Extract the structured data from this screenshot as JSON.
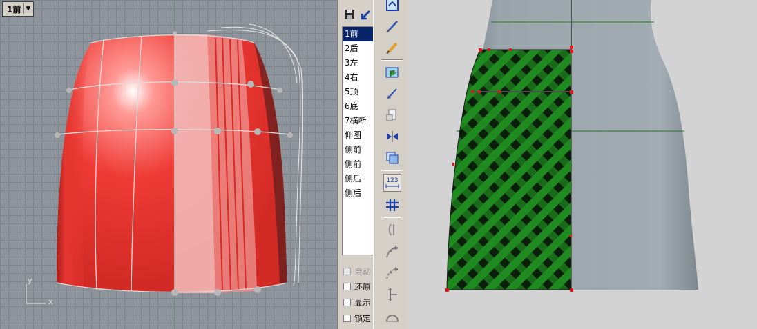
{
  "left_viewport": {
    "tab_label": "1前",
    "axis_y": "y",
    "axis_x": "x"
  },
  "view_panel": {
    "items": [
      "1前",
      "2后",
      "3左",
      "4右",
      "5顶",
      "6底",
      "7横断",
      "仰图",
      "侧前",
      "侧前",
      "侧后",
      "侧后"
    ],
    "selected_index": 0,
    "checkboxes": [
      {
        "label": "自动",
        "checked": false,
        "disabled": true
      },
      {
        "label": "还原",
        "checked": false,
        "disabled": false
      },
      {
        "label": "显示",
        "checked": false,
        "disabled": false
      },
      {
        "label": "锁定",
        "checked": false,
        "disabled": false
      }
    ]
  },
  "toolbar": {
    "tools": [
      {
        "icon": "view-icon",
        "pressed": false
      },
      {
        "icon": "pen-line-icon",
        "pressed": false
      },
      {
        "icon": "pencil-icon",
        "pressed": false
      },
      {
        "icon": "hand-view-icon",
        "pressed": false
      },
      {
        "icon": "arrow-line-icon",
        "pressed": false
      },
      {
        "icon": "cut-icon",
        "pressed": false
      },
      {
        "icon": "mirror-icon",
        "pressed": false
      },
      {
        "icon": "copy-icon",
        "pressed": false
      },
      {
        "icon": "dimension-icon",
        "label": "123",
        "pressed": true
      },
      {
        "icon": "grid-icon",
        "pressed": false
      },
      {
        "icon": "split-icon",
        "pressed": false
      },
      {
        "icon": "curve-add-icon",
        "pressed": false
      },
      {
        "icon": "curve-add-dashed-icon",
        "pressed": false
      },
      {
        "icon": "measure-icon",
        "pressed": false
      },
      {
        "icon": "arc-icon",
        "pressed": false
      }
    ]
  },
  "colors": {
    "skirt_red": "#e8302c",
    "plaid_green": "#1f8a1f",
    "mannequin_gray": "#9aa4ab",
    "selection_blue": "#0a246a"
  }
}
